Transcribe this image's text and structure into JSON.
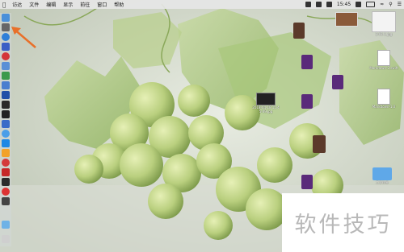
{
  "menubar": {
    "apple_icon": "apple-logo",
    "items": [
      "访达",
      "文件",
      "编辑",
      "显示",
      "前往",
      "窗口",
      "帮助"
    ],
    "clock": "15:45",
    "status_icons": [
      "wifi-icon",
      "battery-icon",
      "search-icon",
      "user-icon",
      "menu-icon"
    ]
  },
  "desktop": {
    "icons": [
      {
        "label": "",
        "kind": "screenshot-icon"
      },
      {
        "label": "2-01-1.jpg",
        "kind": "image-icon"
      },
      {
        "label": "",
        "kind": "book-icon"
      },
      {
        "label": "Markdown-2.swift",
        "kind": "document-icon"
      },
      {
        "label": "",
        "kind": "video-icon"
      },
      {
        "label": "Markdown-1.0",
        "kind": "document-icon"
      },
      {
        "label": "",
        "kind": "video-icon"
      },
      {
        "label": "2018-04-18 15.4\n5-09.jpg",
        "kind": "video-icon"
      },
      {
        "label": "",
        "kind": "video-icon"
      },
      {
        "label": "",
        "kind": "book-icon"
      },
      {
        "label": "",
        "kind": "video-icon"
      },
      {
        "label": "工文件夹",
        "kind": "folder-icon"
      }
    ]
  },
  "watermark": {
    "text": "软件技巧"
  },
  "colors": {
    "annotation_arrow": "#e8702a",
    "watermark_text": "#b8b8b8"
  }
}
